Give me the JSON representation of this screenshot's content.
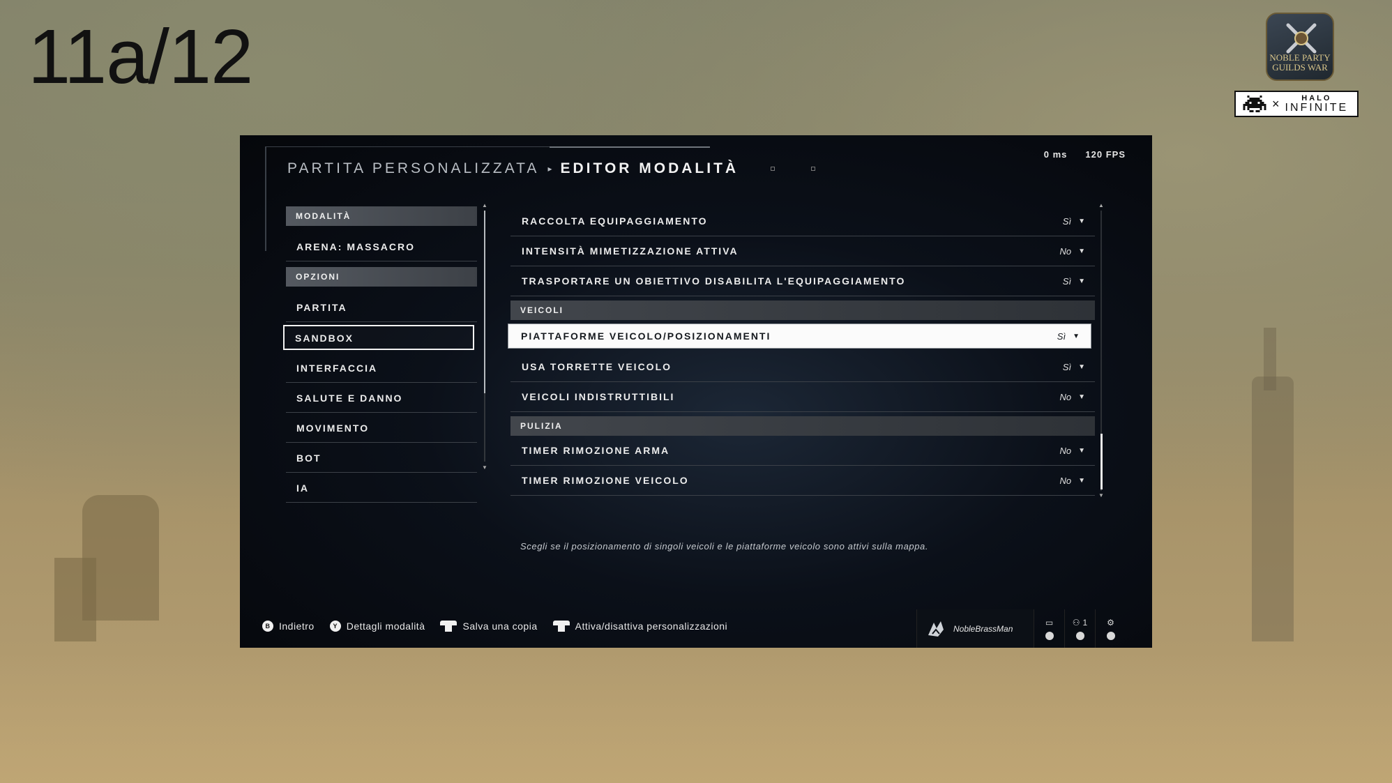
{
  "slide": {
    "number": "11a/12"
  },
  "logos": {
    "noble_party_line1": "NOBLE PARTY",
    "noble_party_line2": "GUILDS WAR",
    "halo_top": "HALO",
    "halo_bottom": "INFINITE"
  },
  "stats": {
    "latency": "0 ms",
    "fps": "120 FPS"
  },
  "breadcrumb": {
    "parent": "PARTITA PERSONALIZZATA",
    "current": "EDITOR MODALITÀ"
  },
  "nav": {
    "modalita_header": "MODALITÀ",
    "mode": "ARENA: MASSACRO",
    "opzioni_header": "OPZIONI",
    "items": [
      {
        "label": "PARTITA",
        "selected": false
      },
      {
        "label": "SANDBOX",
        "selected": true
      },
      {
        "label": "INTERFACCIA",
        "selected": false
      },
      {
        "label": "SALUTE E DANNO",
        "selected": false
      },
      {
        "label": "MOVIMENTO",
        "selected": false
      },
      {
        "label": "BOT",
        "selected": false
      },
      {
        "label": "IA",
        "selected": false
      }
    ]
  },
  "settings": {
    "rows_top": [
      {
        "label": "RACCOLTA EQUIPAGGIAMENTO",
        "value": "Sì"
      },
      {
        "label": "INTENSITÀ MIMETIZZAZIONE ATTIVA",
        "value": "No"
      },
      {
        "label": "TRASPORTARE UN OBIETTIVO DISABILITA L'EQUIPAGGIAMENTO",
        "value": "Sì"
      }
    ],
    "veicoli_header": "VEICOLI",
    "rows_veicoli": [
      {
        "label": "PIATTAFORME VEICOLO/POSIZIONAMENTI",
        "value": "Sì",
        "selected": true
      },
      {
        "label": "USA TORRETTE VEICOLO",
        "value": "Sì"
      },
      {
        "label": "VEICOLI INDISTRUTTIBILI",
        "value": "No"
      }
    ],
    "pulizia_header": "PULIZIA",
    "rows_pulizia": [
      {
        "label": "TIMER RIMOZIONE ARMA",
        "value": "No"
      },
      {
        "label": "TIMER RIMOZIONE VEICOLO",
        "value": "No"
      }
    ]
  },
  "description": "Scegli se il posizionamento di singoli veicoli e le piattaforme veicolo sono attivi sulla mappa.",
  "footer": {
    "back_button": "B",
    "back_label": "Indietro",
    "details_button": "Y",
    "details_label": "Dettagli modalità",
    "save_label": "Salva una copia",
    "toggle_label": "Attiva/disattiva personalizzazioni",
    "gamertag": "NobleBrassMan",
    "party_count": "1"
  }
}
